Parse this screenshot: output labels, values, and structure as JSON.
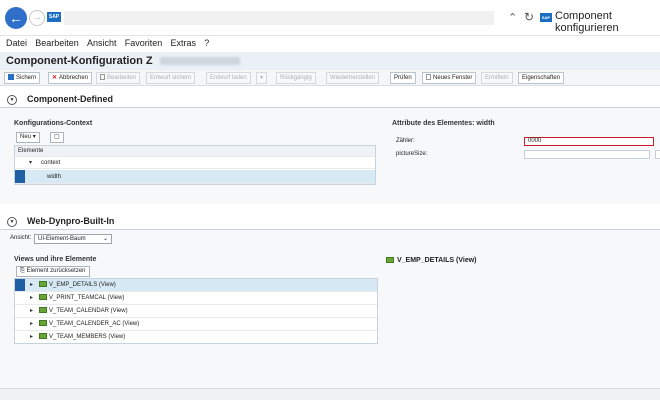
{
  "browser": {
    "tab_title": "Component konfigurieren",
    "sap_logo": "SAP"
  },
  "menu": [
    "Datei",
    "Bearbeiten",
    "Ansicht",
    "Favoriten",
    "Extras",
    "?"
  ],
  "page": {
    "title": "Component-Konfiguration Z"
  },
  "toolbar": [
    {
      "label": "Sichern",
      "icon": "save-icon",
      "enabled": true
    },
    {
      "label": "Abbrechen",
      "icon": "cancel-icon",
      "enabled": true
    },
    {
      "label": "Bearbeiten",
      "icon": "edit-icon",
      "enabled": false
    },
    {
      "label": "Entwurf sichern",
      "enabled": false
    },
    {
      "label": "Entwurf laden",
      "enabled": false
    },
    {
      "label": "Rückgängig",
      "enabled": false
    },
    {
      "label": "Wiederherstellen",
      "enabled": false
    },
    {
      "label": "Prüfen",
      "enabled": true
    },
    {
      "label": "Neues Fenster",
      "icon": "new-window-icon",
      "enabled": true
    },
    {
      "label": "Ermitteln",
      "enabled": false
    },
    {
      "label": "Eigenschaften",
      "enabled": true
    }
  ],
  "component_defined": {
    "title": "Component-Defined",
    "context_label": "Konfigurations-Context",
    "new_button": "Neu",
    "column_header": "Elemente",
    "items": [
      "context",
      "width"
    ],
    "attributes_title": "Attribute des Elementes: width",
    "fields": [
      {
        "label": "Zähler:",
        "value": "0000"
      },
      {
        "label": "pictureSize:",
        "value": ""
      }
    ]
  },
  "web_dynpro": {
    "title": "Web-Dynpro-Built-In",
    "view_label": "Ansicht:",
    "view_value": "UI-Element-Baum",
    "views_title": "Views und ihre Elemente",
    "reset_button": "Element zurücksetzen",
    "views": [
      "V_EMP_DETAILS (View)",
      "V_PRINT_TEAMCAL (View)",
      "V_TEAM_CALENDAR (View)",
      "V_TEAM_CALENDER_AC (View)",
      "V_TEAM_MEMBERS (View)"
    ],
    "detail_title": "V_EMP_DETAILS (View)"
  }
}
